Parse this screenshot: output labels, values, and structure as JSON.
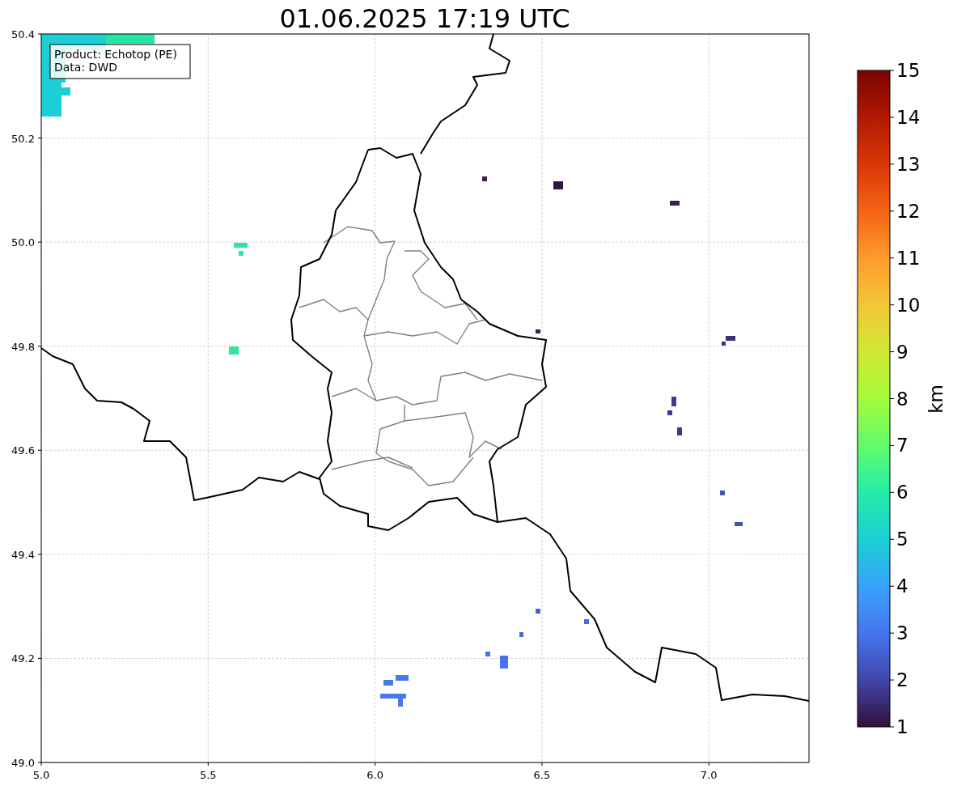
{
  "title": "01.06.2025 17:19 UTC",
  "info_box": {
    "lines": [
      "Product: Echotop (PE)",
      "Data: DWD"
    ]
  },
  "map": {
    "x_tick_labels": [
      "5.0",
      "5.5",
      "6.0",
      "6.5",
      "7.0"
    ],
    "y_tick_labels": [
      "50.4",
      "50.2",
      "50.0",
      "49.8",
      "49.6",
      "49.4",
      "49.2",
      "49.0"
    ]
  },
  "colorbar": {
    "label": "km",
    "tick_labels": [
      "15",
      "14",
      "13",
      "12",
      "11",
      "10",
      "9",
      "8",
      "7",
      "6",
      "5",
      "4",
      "3",
      "2",
      "1"
    ]
  }
}
